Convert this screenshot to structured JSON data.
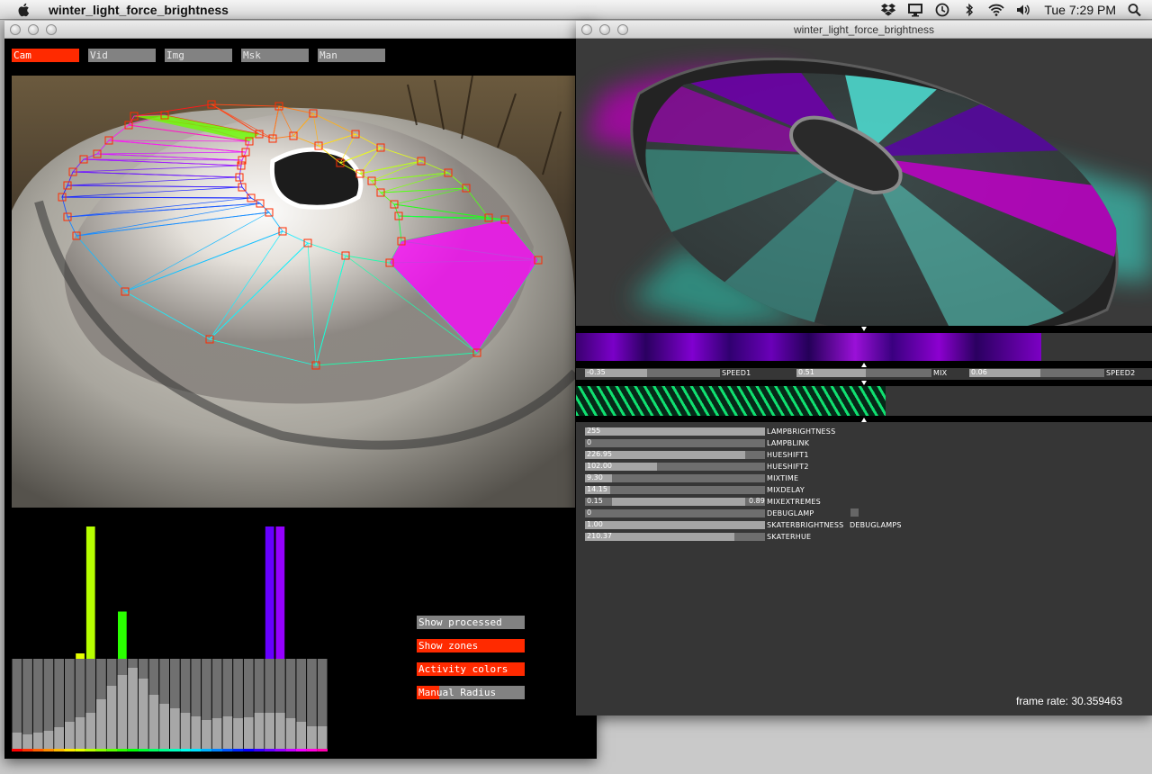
{
  "menubar": {
    "app_name": "winter_light_force_brightness",
    "clock": "Tue 7:29 PM"
  },
  "left_window": {
    "mode_buttons": [
      {
        "label": "Cam",
        "active": true
      },
      {
        "label": "Vid",
        "active": false
      },
      {
        "label": "Img",
        "active": false
      },
      {
        "label": "Msk",
        "active": false
      },
      {
        "label": "Man",
        "active": false
      }
    ],
    "toggles": [
      {
        "label": "Show processed",
        "state": "off"
      },
      {
        "label": "Show zones",
        "state": "on"
      },
      {
        "label": "Activity colors",
        "state": "on"
      },
      {
        "label": "Manual Radius",
        "state": "partial"
      }
    ],
    "activity_levels": [
      0,
      0,
      0,
      0,
      0,
      0,
      0.04,
      0.98,
      0,
      0,
      0.35,
      0,
      0,
      0,
      0,
      0,
      0,
      0,
      0,
      0,
      0,
      0,
      0,
      0,
      0.98,
      0.98,
      0,
      0,
      0,
      0
    ],
    "zone_levels": [
      0.18,
      0.16,
      0.18,
      0.2,
      0.24,
      0.3,
      0.35,
      0.4,
      0.55,
      0.7,
      0.82,
      0.9,
      0.78,
      0.6,
      0.5,
      0.45,
      0.4,
      0.36,
      0.32,
      0.34,
      0.36,
      0.34,
      0.35,
      0.4,
      0.4,
      0.4,
      0.34,
      0.3,
      0.25,
      0.25
    ]
  },
  "right_window": {
    "title": "winter_light_force_brightness",
    "speed_sliders": [
      {
        "value": "-0.35",
        "fraction": 0.46,
        "label": "SPEED1"
      },
      {
        "value": "0.51",
        "fraction": 0.51,
        "label": "MIX"
      },
      {
        "value": "0.06",
        "fraction": 0.53,
        "label": "SPEED2"
      }
    ],
    "params": [
      {
        "value": "255",
        "fraction": 1.0,
        "label": "LAMPBRIGHTNESS"
      },
      {
        "value": "0",
        "fraction": 0.0,
        "label": "LAMPBLINK"
      },
      {
        "value": "226.95",
        "fraction": 0.89,
        "label": "HUESHIFT1"
      },
      {
        "value": "102.00",
        "fraction": 0.4,
        "label": "HUESHIFT2"
      },
      {
        "value": "9.30",
        "fraction": 0.15,
        "label": "MIXTIME"
      },
      {
        "value": "14.15",
        "fraction": 0.14,
        "label": "MIXDELAY"
      },
      {
        "value": "0.15",
        "value2": "0.89",
        "range": [
          0.15,
          0.89
        ],
        "label": "MIXEXTREMES"
      },
      {
        "value": "0",
        "fraction": 0.0,
        "label": "DEBUGLAMP"
      },
      {
        "value": "1.00",
        "fraction": 1.0,
        "label": "SKATERBRIGHTNESS"
      },
      {
        "value": "210.37",
        "fraction": 0.83,
        "label": "SKATERHUE"
      }
    ],
    "debuglamps_label": "DEBUGLAMPS",
    "frame_rate": "frame rate: 30.359463"
  },
  "colors": {
    "accent_red": "#ff2a00",
    "button_gray": "#828282",
    "green": "#6cff00",
    "magenta": "#ff00ff",
    "stripe_green": "#17e07a"
  }
}
